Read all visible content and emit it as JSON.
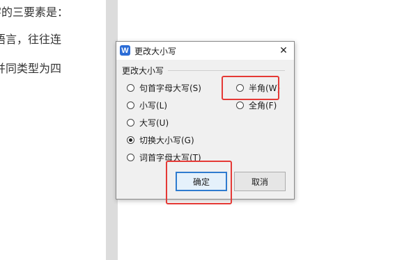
{
  "document": {
    "lines": [
      "字的三要素是：",
      "语言，往往连",
      "并同类型为四"
    ]
  },
  "dialog": {
    "title": "更改大小写",
    "app_icon_glyph": "W",
    "close_glyph": "✕",
    "group_title": "更改大小写",
    "options_left": [
      {
        "label": "句首字母大写(S)",
        "checked": false
      },
      {
        "label": "小写(L)",
        "checked": false
      },
      {
        "label": "大写(U)",
        "checked": false
      },
      {
        "label": "切换大小写(G)",
        "checked": true
      },
      {
        "label": "词首字母大写(T)",
        "checked": false
      }
    ],
    "options_right": [
      {
        "label": "半角(W)",
        "checked": false
      },
      {
        "label": "全角(F)",
        "checked": false
      }
    ],
    "ok_label": "确定",
    "cancel_label": "取消"
  },
  "colors": {
    "highlight": "#e53935",
    "accent": "#2e7bcf",
    "app_icon": "#2b6cd6"
  }
}
